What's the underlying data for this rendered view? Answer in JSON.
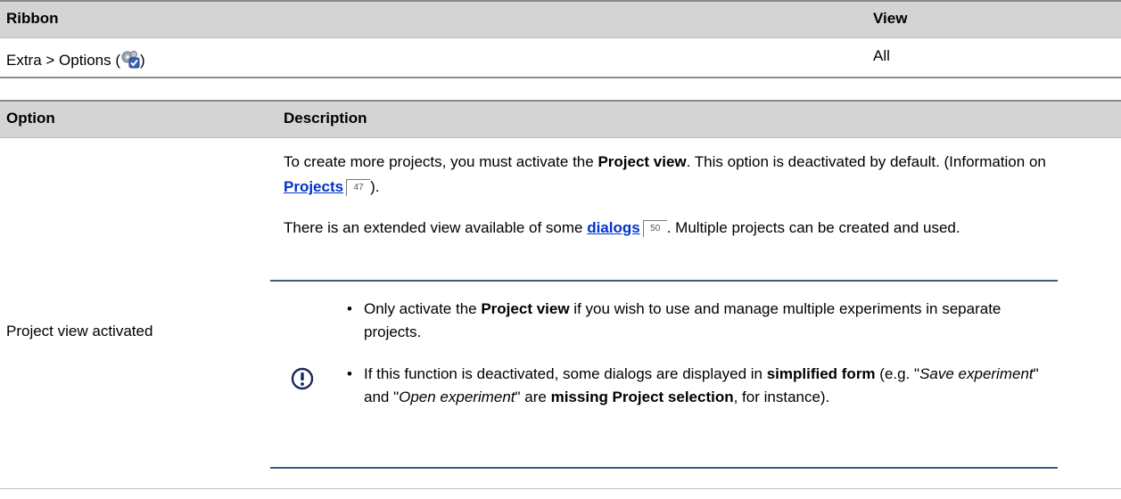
{
  "table1": {
    "header": {
      "col1": "Ribbon",
      "col2": "View"
    },
    "row": {
      "ribbon_prefix": "Extra > Options (",
      "ribbon_suffix": ")",
      "view": "All"
    }
  },
  "table2": {
    "header": {
      "col1": "Option",
      "col2": "Description"
    },
    "option_label": "Project view activated",
    "para1": {
      "t1": "To create more projects, you must activate the ",
      "b1": "Project view",
      "t2": ". This option is deactivated by default. (Information on ",
      "link": "Projects",
      "ref": "47",
      "t3": ")."
    },
    "para2": {
      "t1": "There is an extended view available of some ",
      "link": "dialogs",
      "ref": "50",
      "t2": ". Multiple projects can be created and used."
    },
    "note": {
      "icon": "exclamation-circle-icon",
      "item1": {
        "t1": "Only activate the ",
        "b1": "Project view",
        "t2": " if you wish to use and manage multiple experiments in separate projects."
      },
      "item2": {
        "t1": "If this function is deactivated, some dialogs are displayed in ",
        "b1": "simplified form",
        "t2": " (e.g. \"",
        "i1": "Save experiment",
        "t3": "\" and \"",
        "i2": "Open experiment",
        "t4": "\" are ",
        "b2": "missing Project selection",
        "t5": ", for instance)."
      }
    }
  }
}
